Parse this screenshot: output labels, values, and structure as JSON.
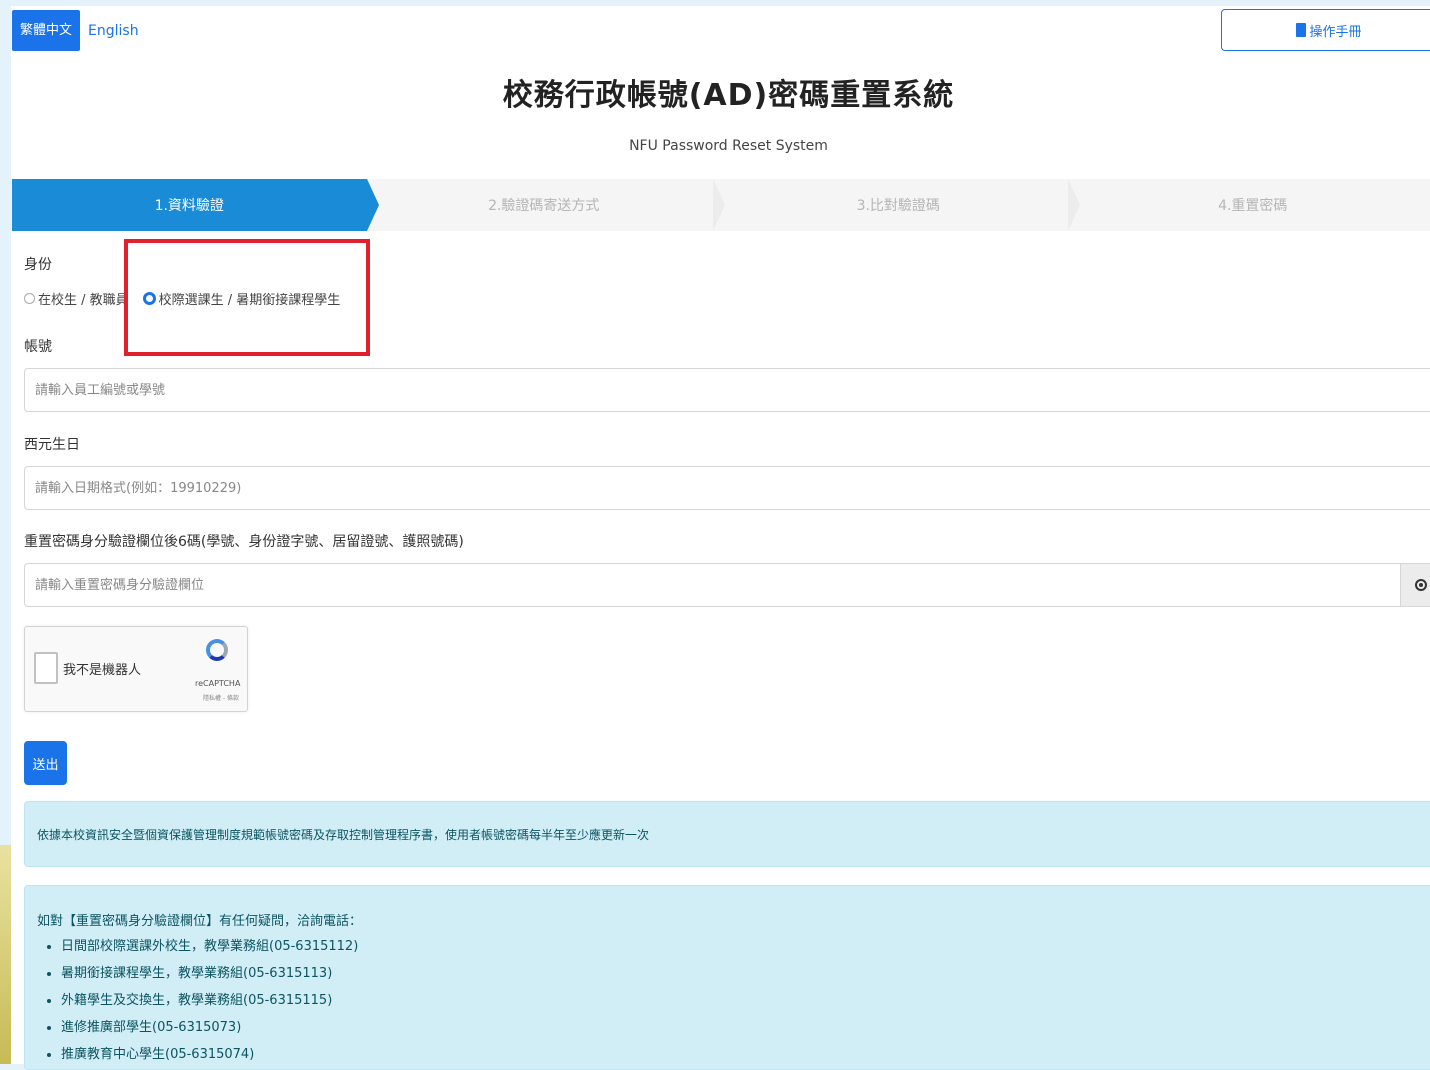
{
  "lang": {
    "zh": "繁體中文",
    "en": "English"
  },
  "header": {
    "manual": "操作手冊",
    "title": "校務行政帳號(AD)密碼重置系統",
    "subtitle": "NFU Password Reset System"
  },
  "steps": [
    "1.資料驗證",
    "2.驗證碼寄送方式",
    "3.比對驗證碼",
    "4.重置密碼"
  ],
  "form": {
    "identity_label": "身份",
    "identity_options": [
      "在校生 / 教職員",
      "校際選課生 / 暑期銜接課程學生"
    ],
    "identity_selected": 1,
    "account_label": "帳號",
    "account_placeholder": "請輸入員工編號或學號",
    "birthday_label": "西元生日",
    "birthday_placeholder": "請輸入日期格式(例如：19910229)",
    "verify_label": "重置密碼身分驗證欄位後6碼(學號、身份證字號、居留證號、護照號碼)",
    "verify_placeholder": "請輸入重置密碼身分驗證欄位",
    "captcha_text": "我不是機器人",
    "captcha_brand": "reCAPTCHA",
    "captcha_terms": "隱私權 - 條款",
    "submit": "送出"
  },
  "notice": "依據本校資訊安全暨個資保護管理制度規範帳號密碼及存取控制管理程序書，使用者帳號密碼每半年至少應更新一次",
  "contact": {
    "head": "如對【重置密碼身分驗證欄位】有任何疑問，洽詢電話：",
    "items": [
      "日間部校際選課外校生，教學業務組(05-6315112)",
      "暑期銜接課程學生，教學業務組(05-6315113)",
      "外籍學生及交換生，教學業務組(05-6315115)",
      "進修推廣部學生(05-6315073)",
      "推廣教育中心學生(05-6315074)"
    ]
  },
  "colors": {
    "primary": "#1a73e8",
    "step_active": "#1a8bd6",
    "alert_bg": "#d1eef7",
    "highlight": "#e0202a"
  },
  "icons": {
    "manual": "book-icon",
    "eye": "eye-icon",
    "captcha": "recaptcha-logo-icon"
  }
}
